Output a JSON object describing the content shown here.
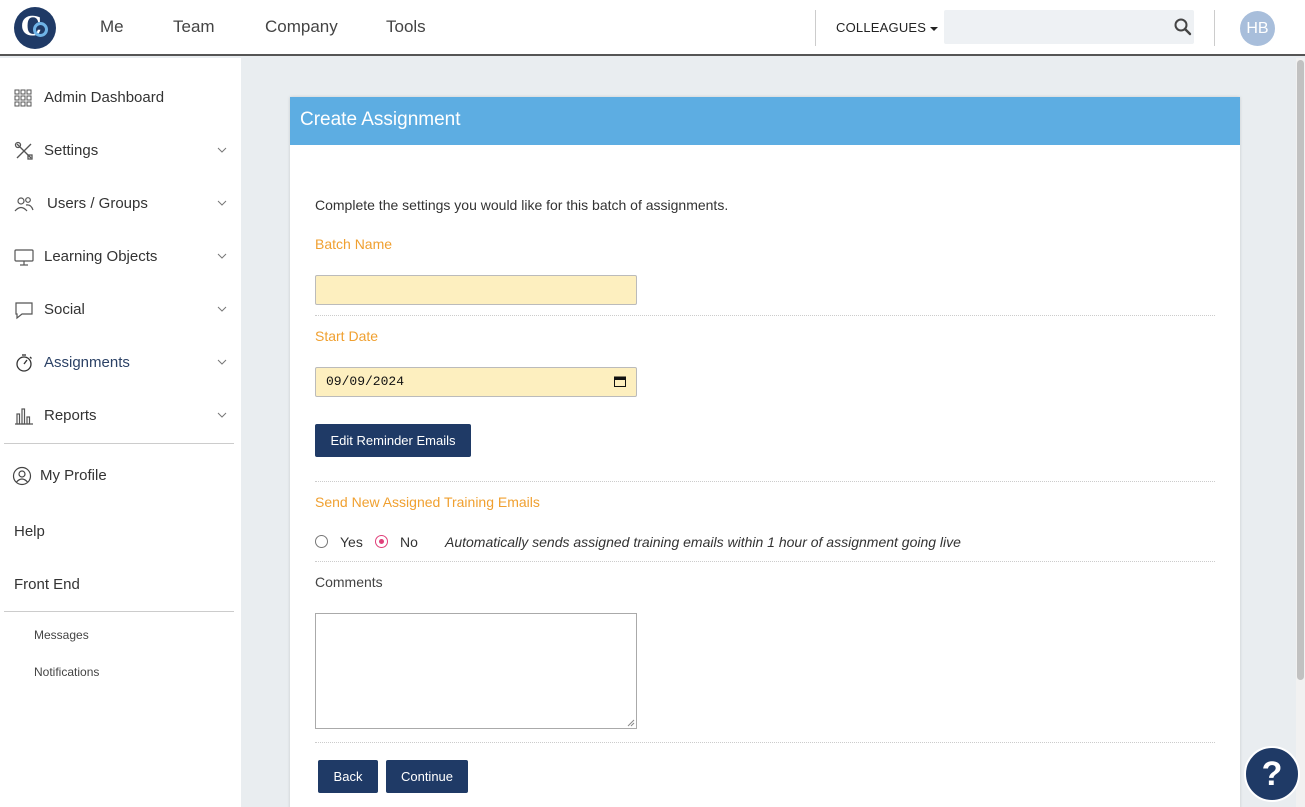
{
  "topbar": {
    "nav": [
      "Me",
      "Team",
      "Company",
      "Tools"
    ],
    "colleagues_label": "COLLEAGUES",
    "search_placeholder": "",
    "avatar_initials": "HB"
  },
  "sidebar": {
    "items": [
      {
        "label": "Admin Dashboard",
        "icon": "grid-icon"
      },
      {
        "label": "Settings",
        "icon": "tools-icon"
      },
      {
        "label": "Users / Groups",
        "icon": "users-icon"
      },
      {
        "label": "Learning Objects",
        "icon": "monitor-icon"
      },
      {
        "label": "Social",
        "icon": "chat-bubble-icon"
      },
      {
        "label": "Assignments",
        "icon": "stopwatch-icon"
      },
      {
        "label": "Reports",
        "icon": "bar-chart-icon"
      }
    ],
    "my_profile": "My Profile",
    "help": "Help",
    "front_end": "Front End",
    "messages": "Messages",
    "notifications": "Notifications"
  },
  "card": {
    "title": "Create Assignment",
    "intro": "Complete the settings you would like for this batch of assignments.",
    "batch_name_label": "Batch Name",
    "batch_name_value": "",
    "start_date_label": "Start Date",
    "start_date_value": "09/09/2024",
    "edit_reminder_label": "Edit Reminder Emails",
    "send_emails_label": "Send New Assigned Training Emails",
    "yes_label": "Yes",
    "no_label": "No",
    "selected_option": "No",
    "hint": "Automatically sends assigned training emails within 1 hour of assignment going live",
    "comments_label": "Comments",
    "back_label": "Back",
    "continue_label": "Continue"
  },
  "help_button": "?",
  "colors": {
    "brand": "#1f3a66",
    "header": "#5dade2",
    "label_orange": "#f0a030",
    "field_yellow": "#fdefbf"
  }
}
